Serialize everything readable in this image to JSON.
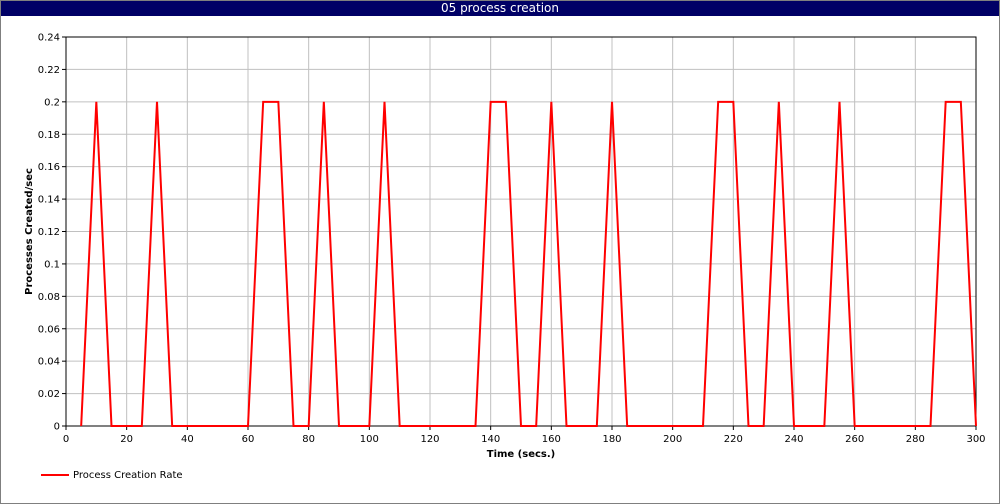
{
  "window": {
    "title": "05 process creation"
  },
  "chart_data": {
    "type": "line",
    "title": "05 process creation",
    "xlabel": "Time (secs.)",
    "ylabel": "Processes Created/sec",
    "xlim": [
      0,
      300
    ],
    "ylim": [
      0,
      0.24
    ],
    "x_ticks": [
      0,
      20,
      40,
      60,
      80,
      100,
      120,
      140,
      160,
      180,
      200,
      220,
      240,
      260,
      280,
      300
    ],
    "y_ticks": [
      0,
      0.02,
      0.04,
      0.06,
      0.08,
      0.1,
      0.12,
      0.14,
      0.16,
      0.18,
      0.2,
      0.22,
      0.24
    ],
    "y_tick_labels": [
      "0",
      "0.02",
      "0.04",
      "0.06",
      "0.08",
      "0.1",
      "0.12",
      "0.14",
      "0.16",
      "0.18",
      "0.2",
      "0.22",
      "0.24"
    ],
    "grid": true,
    "legend_position": "bottom-left",
    "series": [
      {
        "name": "Process Creation Rate",
        "color": "#ff0000",
        "x": [
          5,
          10,
          15,
          25,
          30,
          35,
          60,
          65,
          70,
          75,
          80,
          85,
          90,
          100,
          105,
          110,
          135,
          140,
          145,
          150,
          155,
          160,
          165,
          175,
          180,
          185,
          210,
          215,
          220,
          225,
          230,
          235,
          240,
          250,
          255,
          260,
          285,
          290,
          295,
          300
        ],
        "y": [
          0,
          0.2,
          0,
          0,
          0.2,
          0,
          0,
          0.2,
          0.2,
          0,
          0,
          0.2,
          0,
          0,
          0.2,
          0,
          0,
          0.2,
          0.2,
          0,
          0,
          0.2,
          0,
          0,
          0.2,
          0,
          0,
          0.2,
          0.2,
          0,
          0,
          0.2,
          0,
          0,
          0.2,
          0,
          0,
          0.2,
          0.2,
          0
        ]
      }
    ]
  }
}
